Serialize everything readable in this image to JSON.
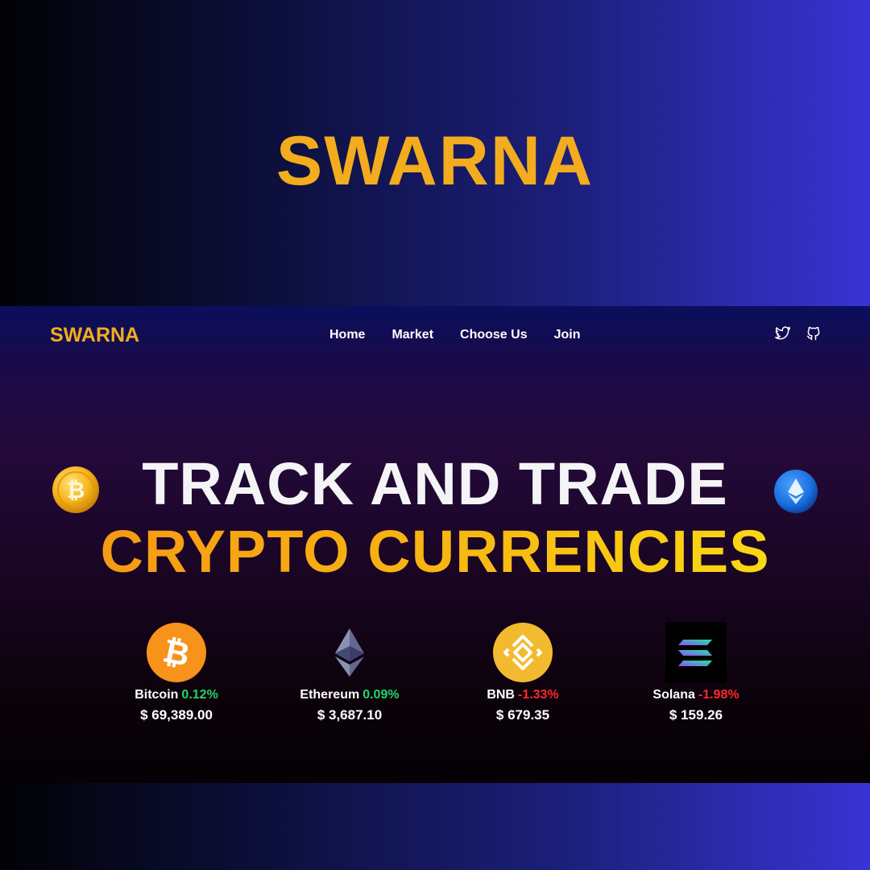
{
  "banner": {
    "title": "SWARNA"
  },
  "nav": {
    "logo": "SWARNA",
    "links": [
      "Home",
      "Market",
      "Choose Us",
      "Join"
    ],
    "social": [
      "twitter-icon",
      "github-icon"
    ]
  },
  "hero": {
    "line1": "TRACK AND TRADE",
    "line2": "CRYPTO CURRENCIES"
  },
  "coins": [
    {
      "name": "Bitcoin",
      "change": "0.12%",
      "trend": "up",
      "price": "$ 69,389.00",
      "icon": "bitcoin-icon"
    },
    {
      "name": "Ethereum",
      "change": "0.09%",
      "trend": "up",
      "price": "$ 3,687.10",
      "icon": "ethereum-icon"
    },
    {
      "name": "BNB",
      "change": "-1.33%",
      "trend": "down",
      "price": "$ 679.35",
      "icon": "bnb-icon"
    },
    {
      "name": "Solana",
      "change": "-1.98%",
      "trend": "down",
      "price": "$ 159.26",
      "icon": "solana-icon"
    }
  ],
  "colors": {
    "brand": "#f2ac1e",
    "up": "#22d46b",
    "down": "#ff2a2a"
  }
}
